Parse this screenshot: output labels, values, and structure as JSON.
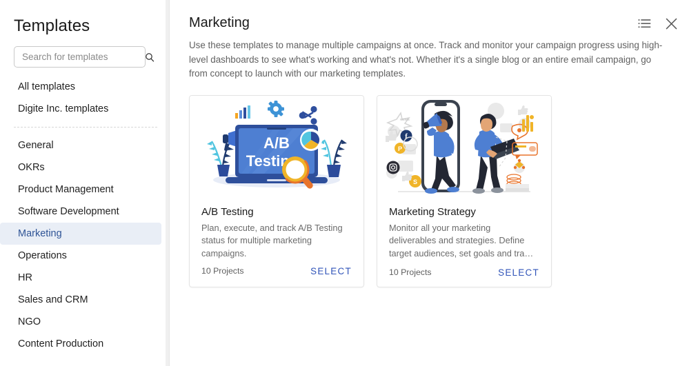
{
  "sidebar": {
    "title": "Templates",
    "search": {
      "placeholder": "Search for templates",
      "value": "",
      "icon": "search-icon"
    },
    "top_items": [
      {
        "label": "All templates",
        "active": false
      },
      {
        "label": "Digite Inc. templates",
        "active": false
      }
    ],
    "categories": [
      {
        "label": "General",
        "active": false
      },
      {
        "label": "OKRs",
        "active": false
      },
      {
        "label": "Product Management",
        "active": false
      },
      {
        "label": "Software Development",
        "active": false
      },
      {
        "label": "Marketing",
        "active": true
      },
      {
        "label": "Operations",
        "active": false
      },
      {
        "label": "HR",
        "active": false
      },
      {
        "label": "Sales and CRM",
        "active": false
      },
      {
        "label": "NGO",
        "active": false
      },
      {
        "label": "Content Production",
        "active": false
      }
    ]
  },
  "main": {
    "title": "Marketing",
    "description": "Use these templates to manage multiple campaigns at once. Track and monitor your campaign progress using high-level dashboards to see what's working and what's not. Whether it's a single blog or an entire email campaign, go from concept to launch with our marketing templates.",
    "actions": [
      {
        "name": "list-view-icon",
        "label": "List view"
      },
      {
        "name": "close-icon",
        "label": "Close"
      }
    ],
    "cards": [
      {
        "title": "A/B Testing",
        "description": "Plan, execute, and track A/B Testing status for multiple marketing campaigns.",
        "count": "10 Projects",
        "select_label": "SELECT",
        "art": "ab-testing-illustration",
        "art_text": "A/B Testing"
      },
      {
        "title": "Marketing Strategy",
        "description": "Monitor all your marketing deliverables and strategies. Define target audiences, set goals and tra…",
        "count": "10 Projects",
        "select_label": "SELECT",
        "art": "marketing-strategy-illustration",
        "art_text": ""
      }
    ]
  },
  "colors": {
    "accent": "#2f53b8",
    "active_nav_text": "#2f5496",
    "active_nav_bg": "#e9eef6",
    "border": "#e3e3e3",
    "text": "#1a1a1a",
    "muted_text": "#6b6b6b"
  }
}
